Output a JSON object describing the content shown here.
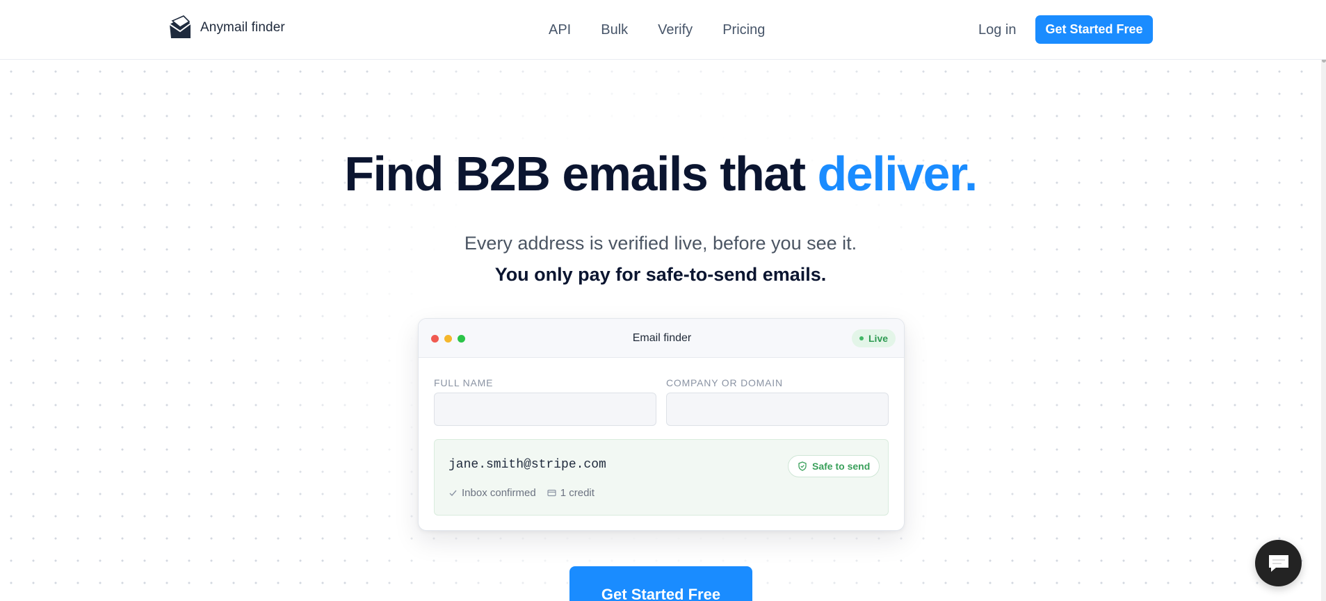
{
  "header": {
    "brand": "Anymail finder",
    "nav": [
      {
        "label": "API"
      },
      {
        "label": "Bulk"
      },
      {
        "label": "Verify"
      },
      {
        "label": "Pricing"
      }
    ],
    "login_label": "Log in",
    "cta_label": "Get Started Free"
  },
  "hero": {
    "title_main": "Find B2B emails that ",
    "title_accent": "deliver.",
    "subtitle": "Every address is verified live, before you see it.",
    "subtitle_bold": "You only pay for safe-to-send emails."
  },
  "card": {
    "title": "Email finder",
    "status_badge": "Live",
    "full_name_label": "FULL NAME",
    "full_name_value": "",
    "company_label": "COMPANY OR DOMAIN",
    "company_value": "",
    "result_email": "jane.smith@stripe.com",
    "result_badge": "Safe to send",
    "meta_inbox": "Inbox confirmed",
    "meta_credit": "1 credit"
  },
  "cta_bottom_label": "Get Started Free",
  "colors": {
    "accent": "#1a8cff",
    "heading": "#0b1530",
    "success": "#3aa05b"
  },
  "icons": [
    "envelope-logo-icon",
    "shield-check-icon",
    "check-icon",
    "credit-card-icon",
    "chat-icon"
  ]
}
